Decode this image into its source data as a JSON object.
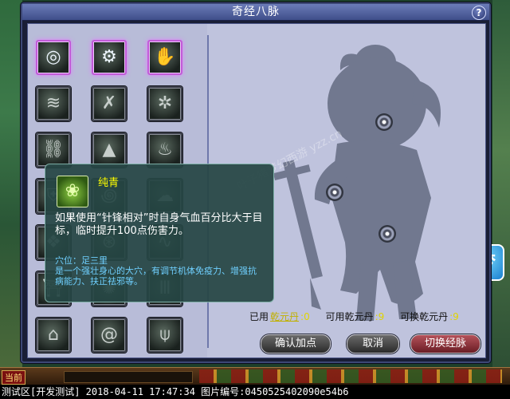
{
  "window": {
    "title": "奇经八脉",
    "help_icon": "?",
    "close_icon": "×"
  },
  "skill_grid": [
    {
      "icon": "eye-sigil-icon",
      "glyph": "◎",
      "active": true
    },
    {
      "icon": "seal-ring-icon",
      "glyph": "⚙",
      "active": true
    },
    {
      "icon": "palm-icon",
      "glyph": "✋",
      "active": true
    },
    {
      "icon": "claw-slash-icon",
      "glyph": "≋"
    },
    {
      "icon": "crossed-swords-icon",
      "glyph": "✗"
    },
    {
      "icon": "spirit-orbs-icon",
      "glyph": "✲"
    },
    {
      "icon": "broken-chain-icon",
      "glyph": "⛓"
    },
    {
      "icon": "mountain-icon",
      "glyph": "▲"
    },
    {
      "icon": "flame-icon",
      "glyph": "♨"
    },
    {
      "icon": "shield-icon",
      "glyph": "⛨"
    },
    {
      "icon": "vortex-icon",
      "glyph": "꩜"
    },
    {
      "icon": "cloud-icon",
      "glyph": "☁"
    },
    {
      "icon": "shield-rune-icon",
      "glyph": "❖"
    },
    {
      "icon": "rune-circle-icon",
      "glyph": "⊛"
    },
    {
      "icon": "wave-icon",
      "glyph": "∿"
    },
    {
      "icon": "gate-icon",
      "glyph": "⛩"
    },
    {
      "icon": "fan-icon",
      "glyph": "✺"
    },
    {
      "icon": "pillar-icon",
      "glyph": "Ⅲ"
    },
    {
      "icon": "pagoda-icon",
      "glyph": "⌂"
    },
    {
      "icon": "swirl-icon",
      "glyph": "@"
    },
    {
      "icon": "trident-icon",
      "glyph": "⍦"
    }
  ],
  "tooltip": {
    "icon": "lotus-icon",
    "name": "纯青",
    "description": "如果使用“针锋相对”时自身气血百分比大于目标，临时提升100点伤害力。",
    "acupoint_title": "穴位：足三里",
    "acupoint_desc": "是一个强壮身心的大穴，有调节机体免疫力、增强抗病能力、扶正祛邪等。"
  },
  "stats": {
    "used_label": "已用",
    "used_link": "乾元丹",
    "used_value": ":0",
    "available_label": "可用乾元丹",
    "available_value": ":9",
    "exchangeable_label": "可换乾元丹",
    "exchangeable_value": ":9"
  },
  "buttons": {
    "confirm": "确认加点",
    "cancel": "取消",
    "switch": "切换经脉"
  },
  "watermark": "叶子猪梦幻西游 yzz.cn",
  "side_logo": "梦",
  "bottom_bar": {
    "current_label": "当前"
  },
  "status_bar": "测试区[开发测试] 2018-04-11 17:47:34 图片编号:0450525402090e54b6"
}
